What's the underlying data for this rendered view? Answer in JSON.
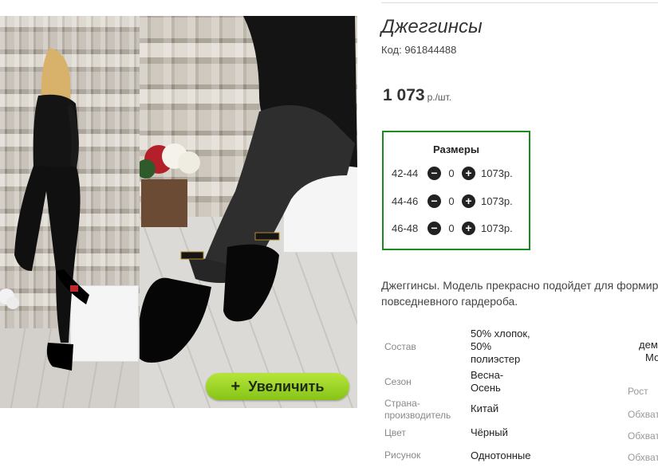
{
  "product": {
    "title": "Джеггинсы",
    "code": "Код: 961844488",
    "price": "1 073",
    "price_unit": "р./шт."
  },
  "gallery": {
    "zoom_label": "Увеличить",
    "zoom_icon": "plus-icon"
  },
  "sizes": {
    "title": "Размеры",
    "rows": [
      {
        "size": "42-44",
        "qty": "0",
        "price": "1073р."
      },
      {
        "size": "44-46",
        "qty": "0",
        "price": "1073р."
      },
      {
        "size": "46-48",
        "qty": "0",
        "price": "1073р."
      }
    ],
    "minus_icon": "minus-circle-icon",
    "plus_icon": "plus-circle-icon"
  },
  "description": {
    "line1": "Джеггинсы. Модель прекрасно подойдет для формир",
    "line2": "повседневного гардероба."
  },
  "specs": [
    {
      "label": "Состав",
      "value_lines": [
        "50% хлопок,",
        "50%",
        "полиэстер"
      ]
    },
    {
      "label": "Сезон",
      "value_lines": [
        "Весна-",
        "Осень"
      ]
    },
    {
      "label_lines": [
        "Страна-",
        "производитель"
      ],
      "value": "Китай"
    },
    {
      "label": "Цвет",
      "value": "Чёрный"
    },
    {
      "label": "Рисунок",
      "value": "Однотонные"
    }
  ],
  "specs_right": {
    "values": [
      "дем",
      "Мо"
    ],
    "labels": [
      "Рост",
      "Обхват",
      "Обхват",
      "Обхват"
    ]
  },
  "colors": {
    "accent_green": "#1c8c1c",
    "zoom_button": "#9bd62a"
  }
}
